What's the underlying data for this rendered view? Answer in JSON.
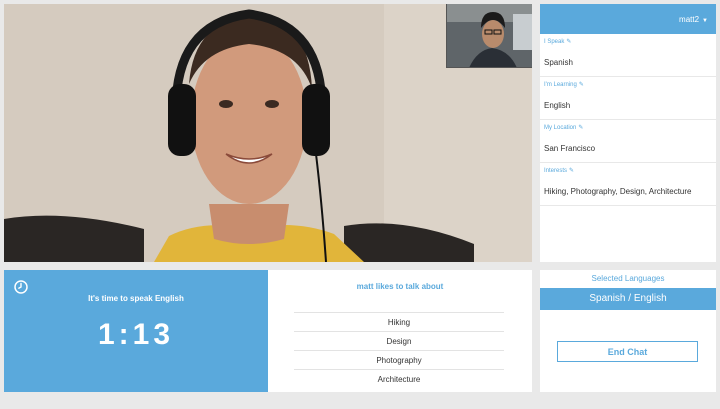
{
  "profile": {
    "username": "matt2",
    "fields": [
      {
        "label": "I Speak",
        "value": "Spanish"
      },
      {
        "label": "I'm Learning",
        "value": "English"
      },
      {
        "label": "My Location",
        "value": "San Francisco"
      },
      {
        "label": "Interests",
        "value": "Hiking, Photography, Design, Architecture"
      }
    ]
  },
  "timer": {
    "prompt": "It's time to speak English",
    "value": "1:13"
  },
  "topics": {
    "title": "matt likes to talk about",
    "items": [
      "Hiking",
      "Design",
      "Photography",
      "Architecture"
    ]
  },
  "languages": {
    "title": "Selected Languages",
    "selected": "Spanish / English",
    "end_chat_label": "End Chat"
  },
  "colors": {
    "accent": "#5aa9dc",
    "background": "#e9e9e9"
  },
  "icons": {
    "clock": "clock-icon",
    "edit": "pencil-icon",
    "caret": "caret-down-icon"
  }
}
